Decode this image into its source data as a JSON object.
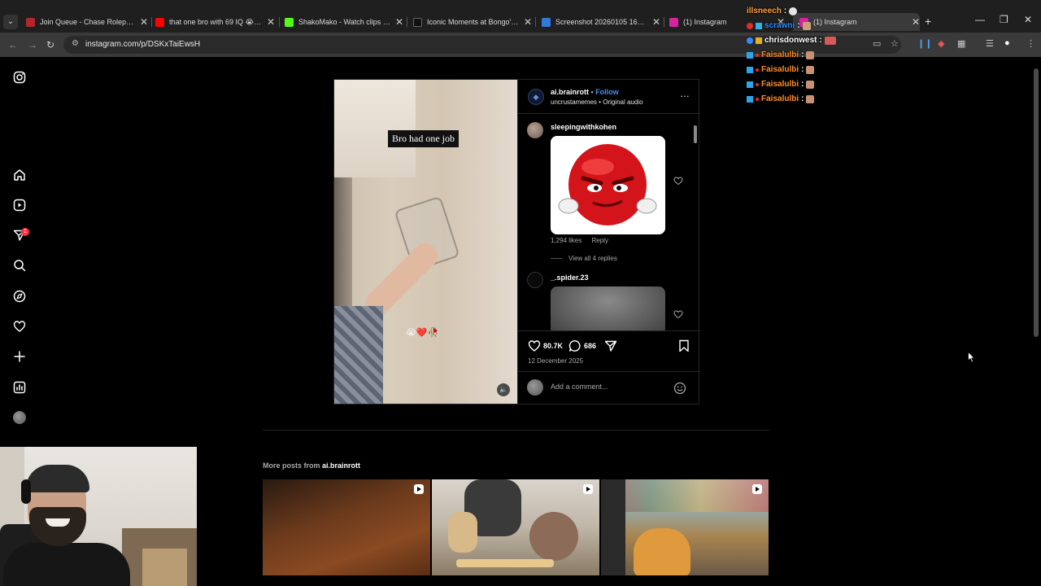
{
  "browser": {
    "tabs": [
      {
        "title": "Join Queue - Chase Roleplay",
        "favicon_color": "#b3262c"
      },
      {
        "title": "that one bro with 69 IQ 😭 #c…",
        "favicon_color": "#ff0000"
      },
      {
        "title": "ShakoMako - Watch clips on K…",
        "favicon_color": "#53fc18"
      },
      {
        "title": "Iconic Moments at Bongo's Bin…",
        "favicon_color": "#111111"
      },
      {
        "title": "Screenshot 20260105 164036 …",
        "favicon_color": "#2f7bd8"
      },
      {
        "title": "(1) Instagram",
        "favicon_color": "#d6249f"
      },
      {
        "title": "(1) Instagram",
        "favicon_color": "#d6249f"
      }
    ],
    "url": "instagram.com/p/DSKxTaiEwsH"
  },
  "chat": {
    "messages": [
      {
        "user": "illsneech",
        "color": "#ff9f3a",
        "emote_color": "#e6e6e6"
      },
      {
        "user": "scrawni",
        "color": "#2f8cff",
        "emote_color": "#c8a27a"
      },
      {
        "user": "chrisdonwest",
        "color": "#ffffff",
        "emote_color": "#d65a5a"
      },
      {
        "user": "Faisalulbi",
        "color": "#ff8c2a",
        "emote_color": "#c79273"
      },
      {
        "user": "Faisalulbi",
        "color": "#ff8c2a",
        "emote_color": "#c79273"
      },
      {
        "user": "Faisalulbi",
        "color": "#ff8c2a",
        "emote_color": "#c79273"
      },
      {
        "user": "Faisalulbi",
        "color": "#ff8c2a",
        "emote_color": "#c79273"
      }
    ]
  },
  "sidebar": {
    "icons": [
      "instagram-icon",
      "home-icon",
      "reels-icon",
      "direct-icon",
      "search-icon",
      "explore-icon",
      "notifications-icon",
      "create-icon",
      "dashboard-icon",
      "profile-avatar"
    ],
    "unread_count": "1"
  },
  "post": {
    "username": "ai.brainrott",
    "follow_label": "Follow",
    "audio_user": "uncrustamemes",
    "audio_label": "Original audio",
    "caption_overlay": "Bro had one job",
    "overlay_emojis": "😭❤️🥀",
    "likes": "80.7K",
    "comments_count": "686",
    "date": "12 December 2025",
    "add_comment_placeholder": "Add a comment..."
  },
  "comments": [
    {
      "user": "sleepingwithkohen",
      "likes": "1,294 likes",
      "reply_label": "Reply",
      "view_replies": "View all 4 replies"
    },
    {
      "user": "_.spider.23"
    }
  ],
  "more_posts": {
    "prefix": "More posts from",
    "user": "ai.brainrott"
  }
}
